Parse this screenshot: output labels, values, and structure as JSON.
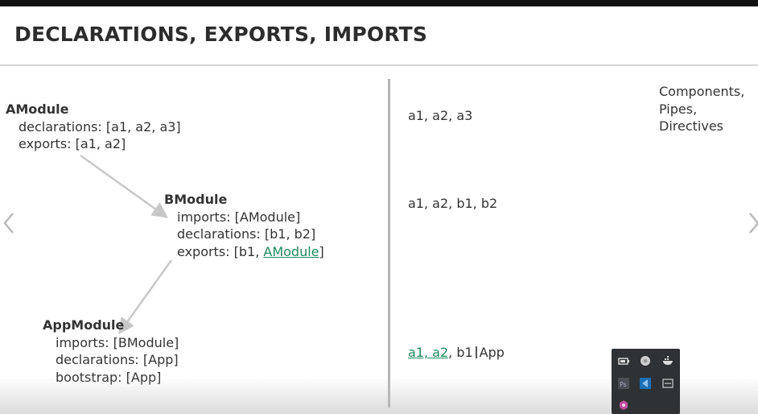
{
  "slide": {
    "title": "DECLARATIONS, EXPORTS, IMPORTS"
  },
  "a_module": {
    "name": "AModule",
    "declarations": "declarations: [a1, a2, a3]",
    "exports": "exports: [a1, a2]"
  },
  "b_module": {
    "name": "BModule",
    "imports": "imports: [AModule]",
    "declarations": "declarations: [b1, b2]",
    "exports_prefix": "exports: [b1, ",
    "exports_link": "AModule",
    "exports_suffix": "]"
  },
  "app_module": {
    "name": "AppModule",
    "imports": "imports: [BModule]",
    "declarations": "declarations: [App]",
    "bootstrap": "bootstrap: [App]"
  },
  "scope": {
    "a": "a1, a2, a3",
    "b": "a1, a2, b1, b2",
    "app_link": "a1, a2",
    "app_mid": ", b1",
    "app_rest": "App"
  },
  "categories": [
    "Components,",
    "Pipes,",
    "Directives"
  ],
  "colors": {
    "link": "#1f8a5e",
    "arrow": "#c8c8c8",
    "title": "#2c2c2c"
  },
  "icons": {
    "nav_prev": "chevron-left-icon",
    "nav_next": "chevron-right-icon",
    "tray": [
      "battery-icon",
      "chrome-icon",
      "docker-icon",
      "photoshop-icon",
      "vscode-icon",
      "terminal-icon",
      "app-icon"
    ]
  }
}
